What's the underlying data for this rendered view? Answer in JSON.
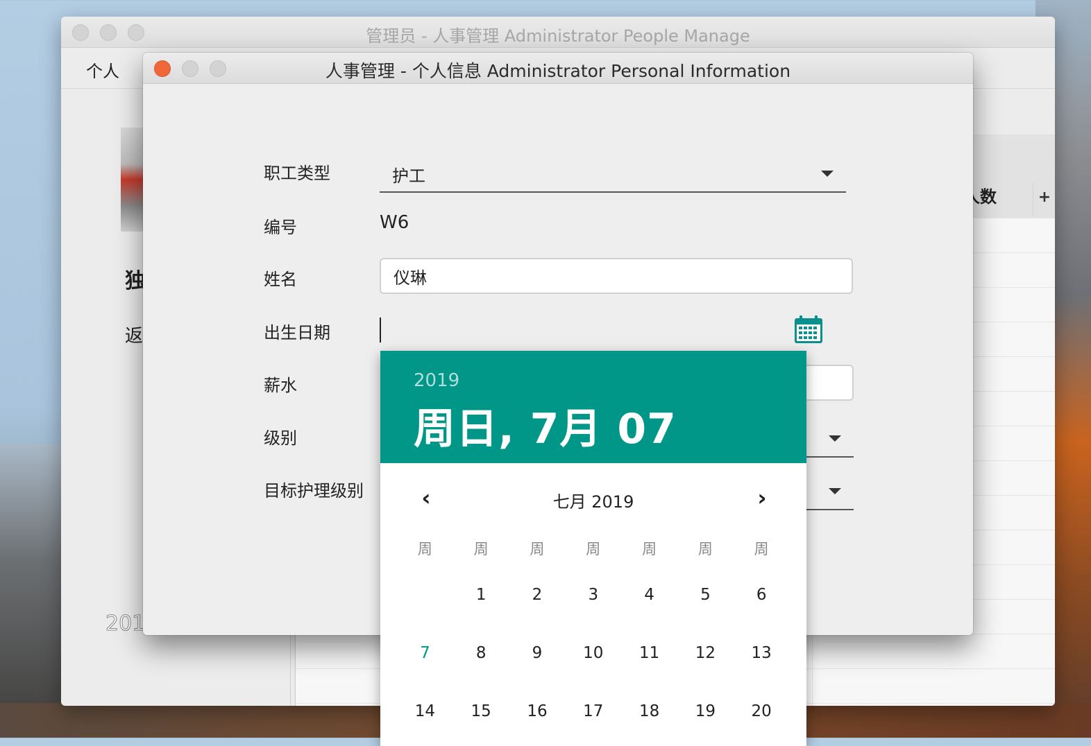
{
  "main_window": {
    "title": "管理员 - 人事管理 Administrator People Manage",
    "menu": [
      "个人"
    ],
    "side_text": [
      "独",
      "返",
      "201"
    ],
    "table_header": "人数",
    "table_add": "+"
  },
  "dialog": {
    "title": "人事管理 - 个人信息 Administrator Personal Information",
    "fields": {
      "staff_type": {
        "label": "职工类型",
        "value": "护工"
      },
      "number": {
        "label": "编号",
        "value": "W6"
      },
      "name": {
        "label": "姓名",
        "value": "仪琳"
      },
      "birthdate": {
        "label": "出生日期",
        "value": ""
      },
      "salary": {
        "label": "薪水"
      },
      "level": {
        "label": "级别"
      },
      "target_care_level": {
        "label": "目标护理级别"
      }
    }
  },
  "datepicker": {
    "year": "2019",
    "selected_date": "周日, 7月 07",
    "month_label": "七月 2019",
    "prev_icon": "‹",
    "next_icon": "›",
    "weekdays": [
      "周",
      "周",
      "周",
      "周",
      "周",
      "周",
      "周"
    ],
    "weeks": [
      [
        "",
        "1",
        "2",
        "3",
        "4",
        "5",
        "6"
      ],
      [
        "7",
        "8",
        "9",
        "10",
        "11",
        "12",
        "13"
      ],
      [
        "14",
        "15",
        "16",
        "17",
        "18",
        "19",
        "20"
      ]
    ],
    "today": "7",
    "accent_color": "#009688"
  }
}
